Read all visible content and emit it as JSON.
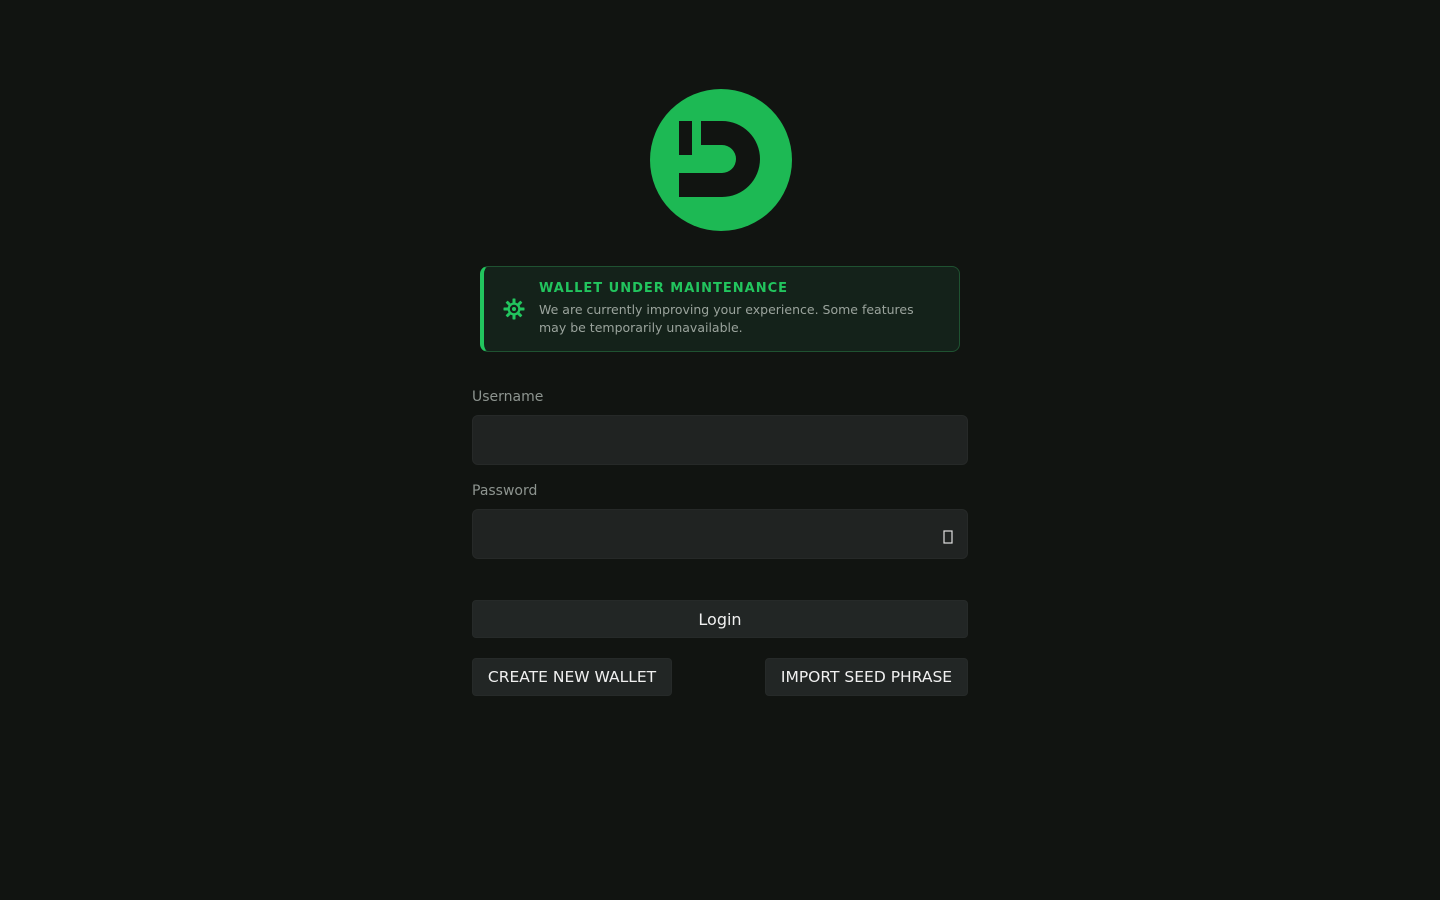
{
  "brand": {
    "logo_icon": "wallet-d-logo-icon",
    "accent_color": "#1db954"
  },
  "notice": {
    "icon": "gear-icon",
    "title": "WALLET UNDER MAINTENANCE",
    "text": "We are currently improving your experience. Some features may be temporarily unavailable.",
    "color": "#22c55e"
  },
  "form": {
    "username": {
      "label": "Username",
      "value": "",
      "placeholder": ""
    },
    "password": {
      "label": "Password",
      "value": "",
      "placeholder": "",
      "toggle_icon": "show-password-icon"
    },
    "login_label": "Login"
  },
  "actions": {
    "create_label": "CREATE NEW WALLET",
    "import_label": "IMPORT SEED PHRASE"
  }
}
